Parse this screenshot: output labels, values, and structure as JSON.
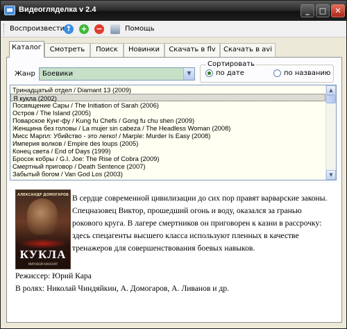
{
  "window": {
    "title": "Видеогляделка v 2.4"
  },
  "title_buttons": {
    "min": "_",
    "max": "□",
    "close": "✕"
  },
  "toolbar": {
    "play_label": "Воспроизвести",
    "help_label": "Помощь",
    "icons": [
      "up-arrow-icon",
      "add-icon",
      "delete-icon",
      "help-book-icon"
    ]
  },
  "tabs": [
    {
      "label": "Каталог",
      "active": true
    },
    {
      "label": "Смотреть"
    },
    {
      "label": "Поиск"
    },
    {
      "label": "Новинки"
    },
    {
      "label": "Скачать в flv"
    },
    {
      "label": "Скачать в avi"
    }
  ],
  "filter": {
    "genre_label": "Жанр",
    "genre_value": "Боевики",
    "sort_legend": "Сортировать",
    "sort_by_date": "по дате",
    "sort_by_name": "по названию",
    "selected_sort": "по дате"
  },
  "movies": [
    "Тринадцатый отдел / Diamant 13 (2009)",
    "Я кукла (2002)",
    "Посвящение Сары / The Initiation of Sarah (2006)",
    "Остров / The Island (2005)",
    "Поварское Кунг-фу / Kung fu Chefs / Gong fu chu shen (2009)",
    "Женщина без головы / La mujer sin cabeza / The Headless Woman (2008)",
    "Мисс Марпл: Убийство - это легко! / Marple: Murder Is Easy (2008)",
    "Империя волков / Empire des loups (2005)",
    "Конец света / End of Days (1999)",
    "Бросок кобры / G.I. Joe: The Rise of Cobra (2009)",
    "Смертный приговор / Death Sentence (2007)",
    "Забытый богом / Van God Los (2003)"
  ],
  "selected_movie_index": 1,
  "details": {
    "poster": {
      "top_text": "АЛЕКСАНДР ДОМОГАРОВ",
      "title": "КУКЛА",
      "bottom_text": "МИРОВОЙ КИНОХИТ"
    },
    "description": "В сердце современной цивилизации до сих пор правят варварские законы. Спецназовец Виктор, прошедший огонь и воду, оказался за гранью рокового круга. В лагере смертников он приговорен к казни в рассрочку: здесь спецагенты высшего класса используют пленных в качестве тренажеров для совершенствования боевых навыков.",
    "director": "Режиссер: Юрий Кара",
    "cast": "В ролях: Николай Чиндяйкин, А. Домогаров, А. Ливанов и др."
  },
  "colors": {
    "titlebar": "#1e1e1e",
    "genre_bg": "#c6e1c8",
    "list_bg": "#fffff2",
    "selection_bg": "#dcdcd4"
  }
}
